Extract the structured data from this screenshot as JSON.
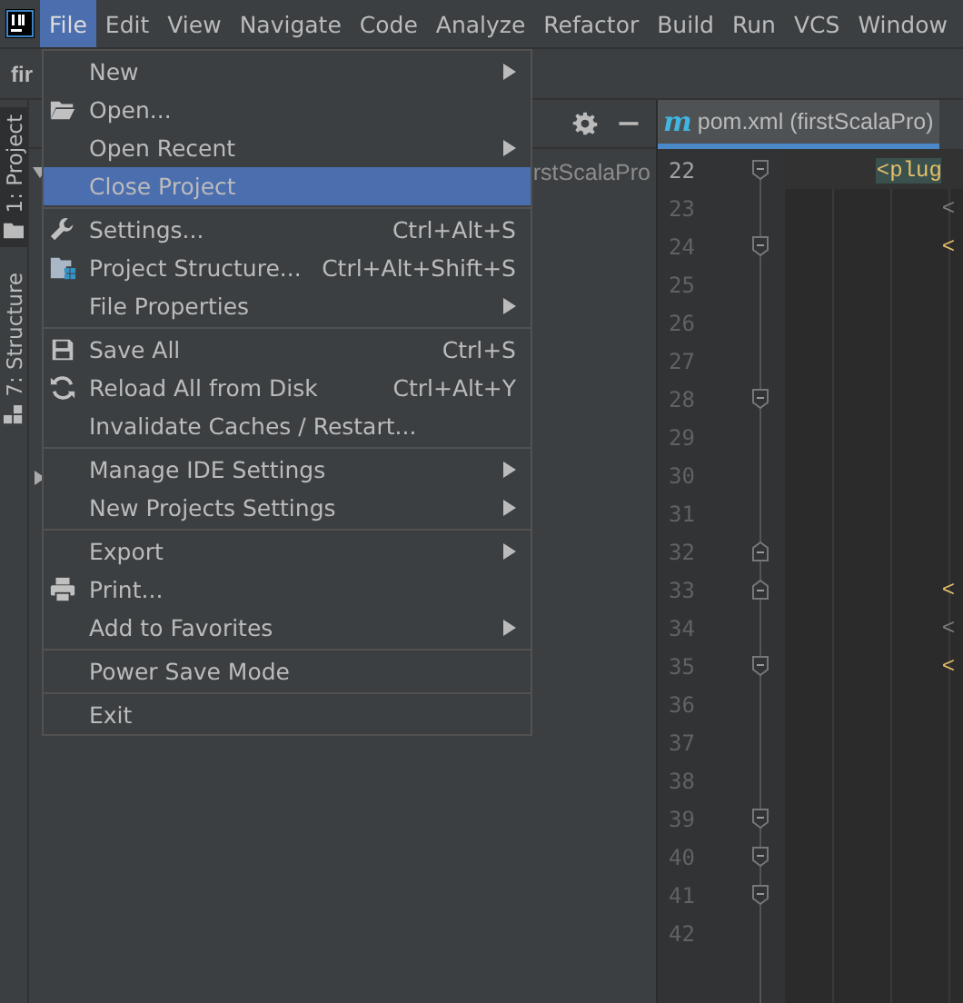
{
  "menubar": [
    {
      "label": "File",
      "selected": true
    },
    {
      "label": "Edit",
      "selected": false
    },
    {
      "label": "View",
      "selected": false
    },
    {
      "label": "Navigate",
      "selected": false
    },
    {
      "label": "Code",
      "selected": false
    },
    {
      "label": "Analyze",
      "selected": false
    },
    {
      "label": "Refactor",
      "selected": false
    },
    {
      "label": "Build",
      "selected": false
    },
    {
      "label": "Run",
      "selected": false
    },
    {
      "label": "VCS",
      "selected": false
    },
    {
      "label": "Window",
      "selected": false
    }
  ],
  "project_panel": {
    "title": "fir",
    "tree_text": "rstScalaPro"
  },
  "tool_window_tabs": [
    {
      "label": "1: Project",
      "selected": true
    },
    {
      "label": "7: Structure",
      "selected": false
    }
  ],
  "editor": {
    "tab": {
      "badge": "m",
      "label": "pom.xml (firstScalaPro)"
    },
    "lines": [
      {
        "number": "22",
        "current": true,
        "fold_start": true,
        "fold_end": false,
        "code": "       <plug",
        "kind": "matched"
      },
      {
        "number": "23",
        "current": false,
        "fold_start": false,
        "fold_end": false,
        "code": "            <",
        "kind": "dim"
      },
      {
        "number": "24",
        "current": false,
        "fold_start": true,
        "fold_end": false,
        "code": "            <",
        "kind": "tag"
      },
      {
        "number": "25",
        "current": false,
        "fold_start": false,
        "fold_end": false
      },
      {
        "number": "26",
        "current": false,
        "fold_start": false,
        "fold_end": false
      },
      {
        "number": "27",
        "current": false,
        "fold_start": false,
        "fold_end": false
      },
      {
        "number": "28",
        "current": false,
        "fold_start": true,
        "fold_end": false
      },
      {
        "number": "29",
        "current": false,
        "fold_start": false,
        "fold_end": false
      },
      {
        "number": "30",
        "current": false,
        "fold_start": false,
        "fold_end": false
      },
      {
        "number": "31",
        "current": false,
        "fold_start": false,
        "fold_end": false
      },
      {
        "number": "32",
        "current": false,
        "fold_start": false,
        "fold_end": true
      },
      {
        "number": "33",
        "current": false,
        "fold_start": false,
        "fold_end": true,
        "code": "            <",
        "kind": "tag"
      },
      {
        "number": "34",
        "current": false,
        "fold_start": false,
        "fold_end": false,
        "code": "            <",
        "kind": "dim"
      },
      {
        "number": "35",
        "current": false,
        "fold_start": true,
        "fold_end": false,
        "code": "            <",
        "kind": "tag"
      },
      {
        "number": "36",
        "current": false,
        "fold_start": false,
        "fold_end": false
      },
      {
        "number": "37",
        "current": false,
        "fold_start": false,
        "fold_end": false
      },
      {
        "number": "38",
        "current": false,
        "fold_start": false,
        "fold_end": false
      },
      {
        "number": "39",
        "current": false,
        "fold_start": true,
        "fold_end": false
      },
      {
        "number": "40",
        "current": false,
        "fold_start": true,
        "fold_end": false
      },
      {
        "number": "41",
        "current": false,
        "fold_start": true,
        "fold_end": false
      },
      {
        "number": "42",
        "current": false,
        "fold_start": false,
        "fold_end": false
      }
    ]
  },
  "file_menu": {
    "items": [
      {
        "kind": "item",
        "label": "New",
        "submenu": true,
        "selected": false
      },
      {
        "kind": "item",
        "label": "Open...",
        "submenu": false,
        "selected": false
      },
      {
        "kind": "item",
        "label": "Open Recent",
        "submenu": true,
        "selected": false
      },
      {
        "kind": "item",
        "label": "Close Project",
        "submenu": false,
        "selected": true
      },
      {
        "kind": "separator"
      },
      {
        "kind": "item",
        "label": "Settings...",
        "shortcut": "Ctrl+Alt+S",
        "submenu": false,
        "selected": false
      },
      {
        "kind": "item",
        "label": "Project Structure...",
        "shortcut": "Ctrl+Alt+Shift+S",
        "submenu": false,
        "selected": false
      },
      {
        "kind": "item",
        "label": "File Properties",
        "submenu": true,
        "selected": false
      },
      {
        "kind": "separator"
      },
      {
        "kind": "item",
        "label": "Save All",
        "shortcut": "Ctrl+S",
        "submenu": false,
        "selected": false
      },
      {
        "kind": "item",
        "label": "Reload All from Disk",
        "shortcut": "Ctrl+Alt+Y",
        "submenu": false,
        "selected": false
      },
      {
        "kind": "item",
        "label": "Invalidate Caches / Restart...",
        "submenu": false,
        "selected": false
      },
      {
        "kind": "separator"
      },
      {
        "kind": "item",
        "label": "Manage IDE Settings",
        "submenu": true,
        "selected": false
      },
      {
        "kind": "item",
        "label": "New Projects Settings",
        "submenu": true,
        "selected": false
      },
      {
        "kind": "separator"
      },
      {
        "kind": "item",
        "label": "Export",
        "submenu": true,
        "selected": false
      },
      {
        "kind": "item",
        "label": "Print...",
        "submenu": false,
        "selected": false
      },
      {
        "kind": "item",
        "label": "Add to Favorites",
        "submenu": true,
        "selected": false
      },
      {
        "kind": "separator"
      },
      {
        "kind": "item",
        "label": "Power Save Mode",
        "submenu": false,
        "selected": false
      },
      {
        "kind": "separator"
      },
      {
        "kind": "item",
        "label": "Exit",
        "submenu": false,
        "selected": false
      }
    ]
  }
}
